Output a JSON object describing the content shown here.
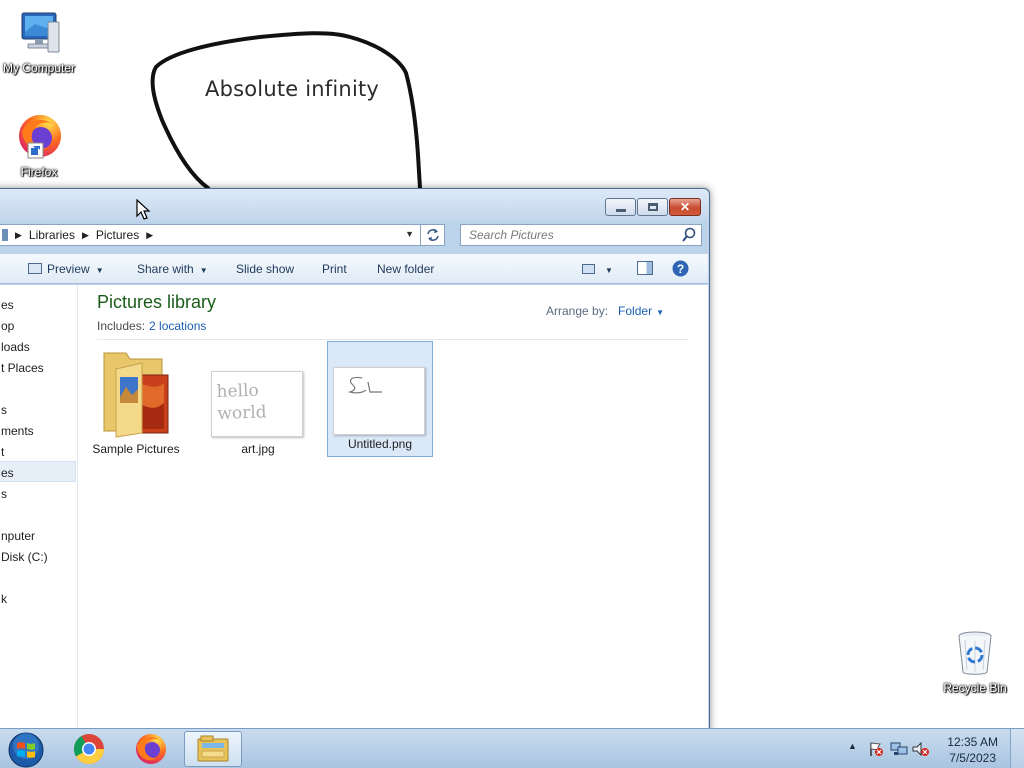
{
  "desktop": {
    "icons": [
      {
        "label": "My Computer",
        "icon": "computer-icon"
      },
      {
        "label": "Firefox",
        "icon": "firefox-icon"
      },
      {
        "label": "Recycle Bin",
        "icon": "recycle-bin-icon"
      }
    ],
    "doodle_text": "Absolute infinity"
  },
  "explorer": {
    "breadcrumb": [
      "Libraries",
      "Pictures"
    ],
    "search_placeholder": "Search Pictures",
    "toolbar": {
      "preview": "Preview",
      "share_with": "Share with",
      "slide_show": "Slide show",
      "print": "Print",
      "new_folder": "New folder"
    },
    "nav_items": [
      "es",
      "op",
      "loads",
      "t Places",
      "s",
      "ments",
      "t",
      "es",
      "s",
      "nputer",
      "Disk (C:)",
      "k"
    ],
    "library_title": "Pictures library",
    "includes_label": "Includes:",
    "includes_link": "2 locations",
    "arrange_label": "Arrange by:",
    "arrange_value": "Folder",
    "files": [
      {
        "name": "Sample Pictures",
        "type": "folder"
      },
      {
        "name": "art.jpg",
        "type": "image",
        "thumb_text": "hello world"
      },
      {
        "name": "Untitled.png",
        "type": "image",
        "selected": true
      }
    ]
  },
  "taskbar": {
    "apps": [
      "chrome-icon",
      "firefox-icon",
      "file-explorer-icon"
    ],
    "time": "12:35 AM",
    "date": "7/5/2023"
  },
  "colors": {
    "library_title": "#1a5d1a",
    "link": "#1b5fb4",
    "selection": "#dbe8f8",
    "close_button": "#c74a2e"
  }
}
